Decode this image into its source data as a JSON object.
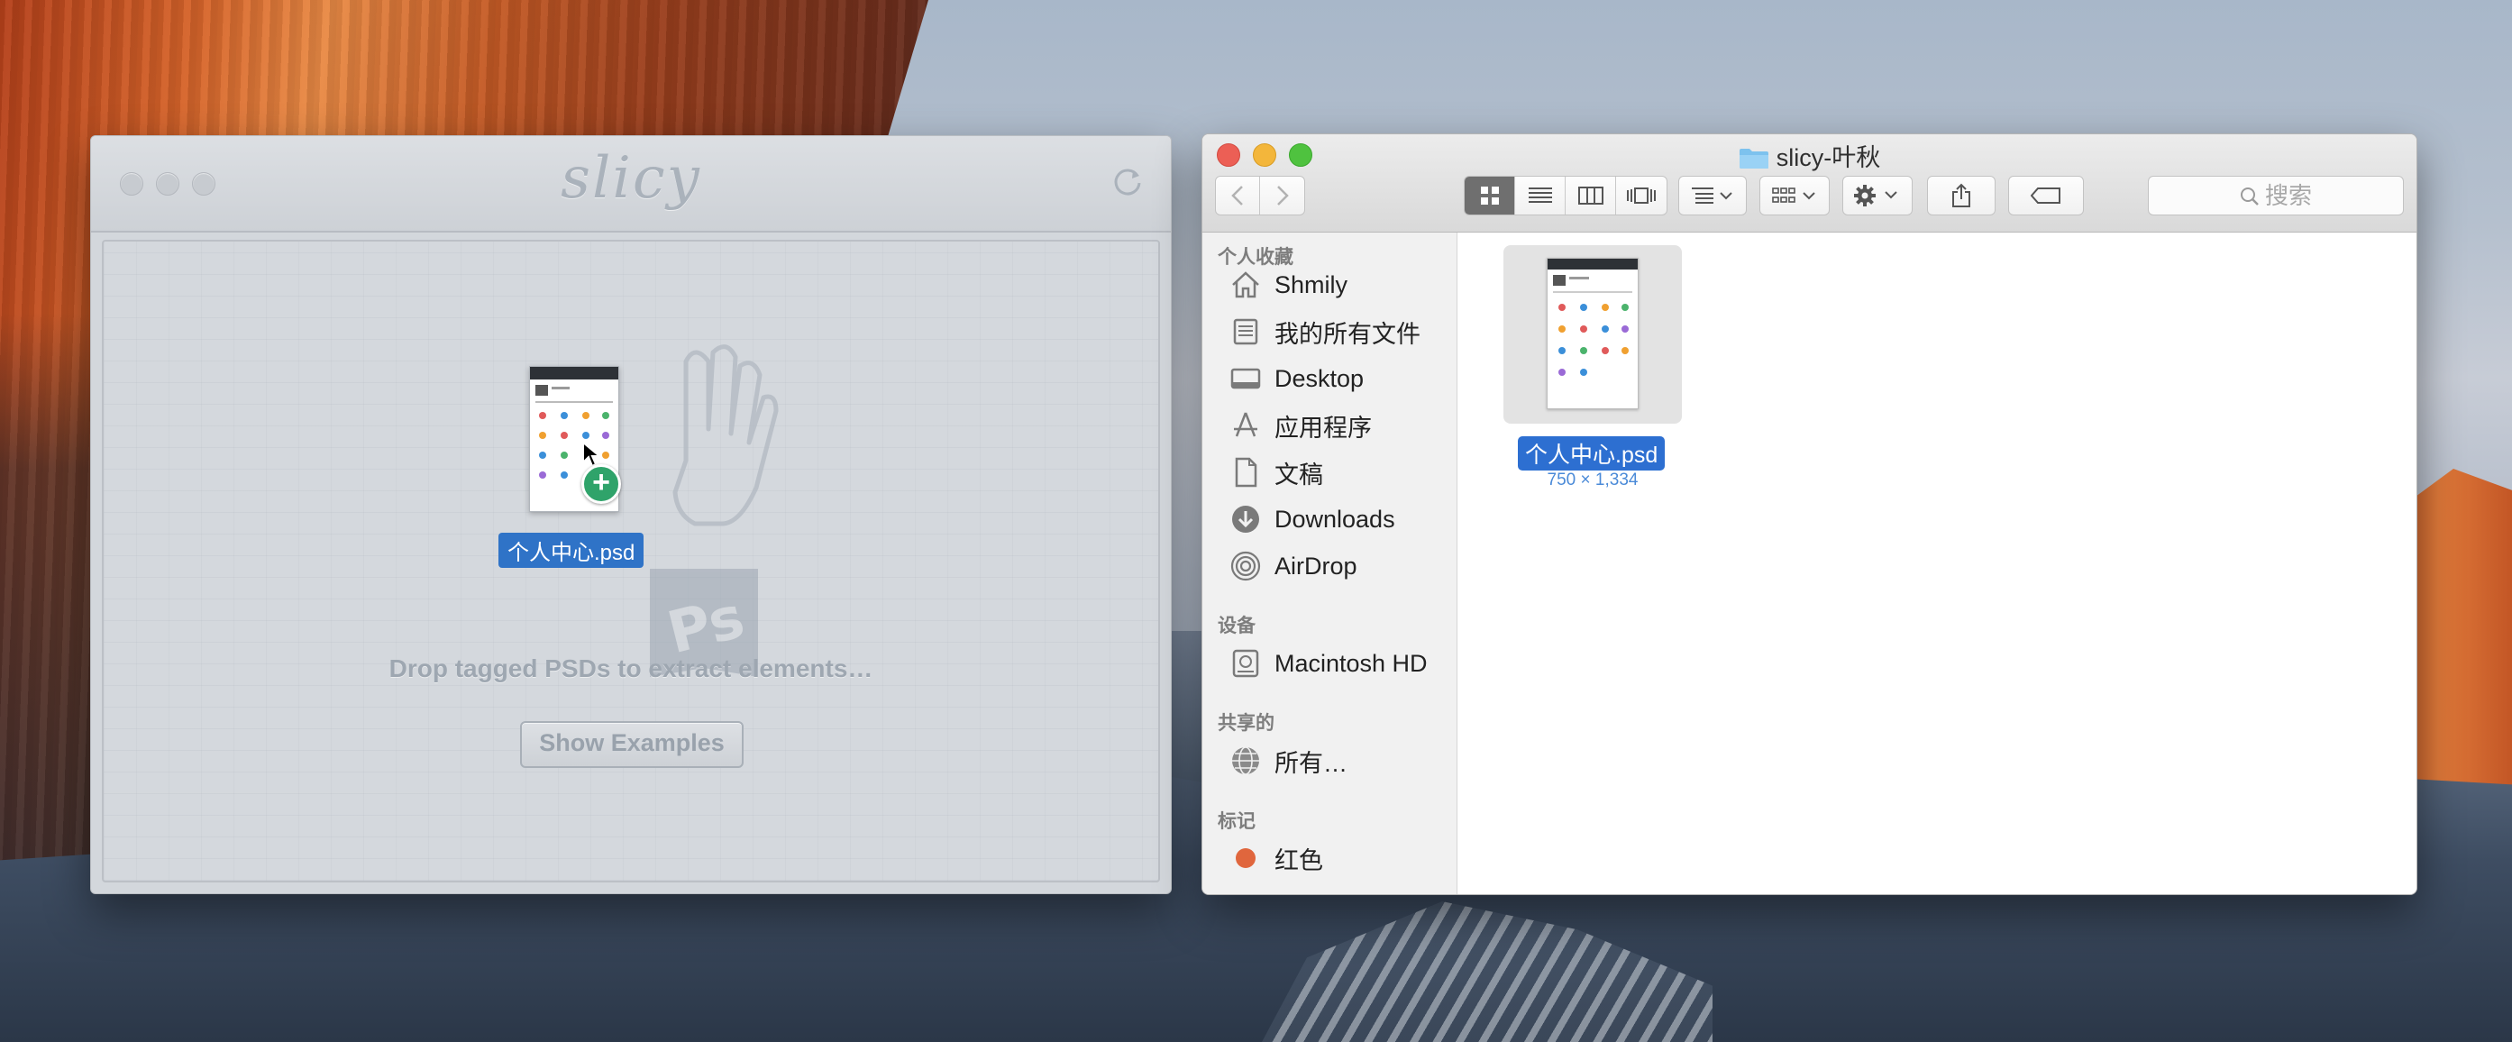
{
  "slicy": {
    "app_name": "slicy",
    "drag_file_name": "个人中心.psd",
    "hint": "Drop tagged PSDs to extract elements…",
    "show_examples_label": "Show Examples"
  },
  "finder": {
    "title": "slicy-叶秋",
    "search_placeholder": "搜索",
    "sidebar": {
      "favorites_header": "个人收藏",
      "favorites": [
        {
          "label": "Shmily",
          "icon": "home-icon"
        },
        {
          "label": "我的所有文件",
          "icon": "all-files-icon"
        },
        {
          "label": "Desktop",
          "icon": "desktop-icon"
        },
        {
          "label": "应用程序",
          "icon": "applications-icon"
        },
        {
          "label": "文稿",
          "icon": "documents-icon"
        },
        {
          "label": "Downloads",
          "icon": "downloads-icon"
        },
        {
          "label": "AirDrop",
          "icon": "airdrop-icon"
        }
      ],
      "devices_header": "设备",
      "devices": [
        {
          "label": "Macintosh HD",
          "icon": "hard-drive-icon"
        }
      ],
      "shared_header": "共享的",
      "shared": [
        {
          "label": "所有…",
          "icon": "network-globe-icon"
        }
      ],
      "tags_header": "标记",
      "tags": [
        {
          "label": "红色",
          "color": "#e0663d"
        }
      ]
    },
    "files": [
      {
        "name": "个人中心.psd",
        "dimensions": "750 × 1,334"
      }
    ],
    "colors": {
      "close": "#ec5f55",
      "minimize": "#f3b63b",
      "zoom": "#4fc23f",
      "selection": "#2d6fd1"
    }
  }
}
